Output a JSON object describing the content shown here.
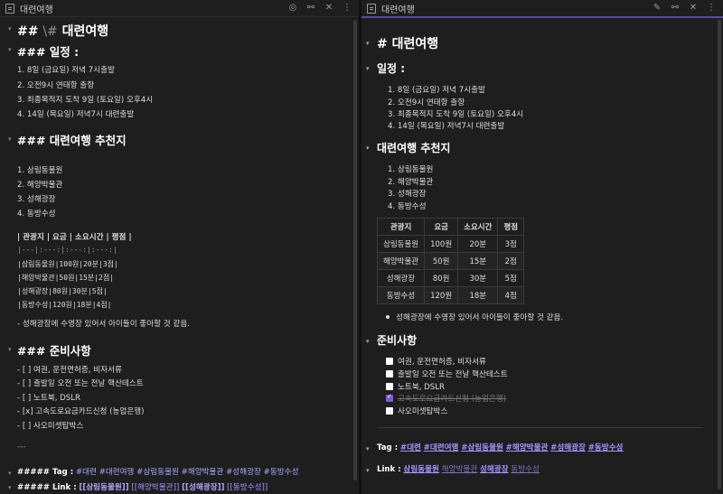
{
  "left_pane": {
    "tab_title": "대련여행",
    "icons": [
      "reading-glasses-icon",
      "link-icon",
      "close-icon",
      "more-icon"
    ],
    "lines": {
      "h2_mark": "##",
      "h2_escape": "\\#",
      "h2_text": "대련여행",
      "h3_schedule": "### 일정 :",
      "schedule": [
        "1. 8일 (금요일) 저녁 7시출발",
        "2. 오전9시 연태항 출항",
        "3. 최종목적지 도착 9일 (토요일) 오후4시",
        "4. 14일 (목요일) 저녁7시 대련출발"
      ],
      "h3_reco": "### 대련여행 추천지",
      "reco": [
        "1. 삼림동물원",
        "2. 해양박물관",
        "3. 성해광장",
        "4. 동방수성"
      ],
      "table_src": [
        "| 관광지 | 요금 | 소요시간 | 평점 |",
        "|---|:---:|:---:|:---:|",
        "|삼림동물원|100원|20분|3점|",
        "|해양박물관|50원|15분|2점|",
        "|성해광장|80원|30분|5점|",
        "|동방수성|120원|18분|4점|"
      ],
      "note": "- 성해광장에 수영장 있어서 아이들이 좋아할 것 같음.",
      "h3_prep": "### 준비사항",
      "prep": [
        "- [ ] 여권, 운전면허증, 비자서류",
        "- [ ] 출발일 오전 또는 전날 핵산테스트",
        "- [ ] 노트북, DSLR",
        "- [x] 고속도로요금카드신청 (농업은행)",
        "- [ ] 사오미셋탑박스"
      ],
      "rule": "---",
      "tag_prefix": "##### Tag :",
      "tag_items": "#대련 #대련여행 #삼림동물원 #해양박물관 #성해광장 #동방수성",
      "link_prefix": "##### Link :",
      "link_items": [
        "[[삼림동물원]]",
        "[[해양박물관]]",
        "[[성해광장]]",
        "[[동방수성]]"
      ]
    }
  },
  "right_pane": {
    "tab_title": "대련여행",
    "icons": [
      "edit-icon",
      "link-icon",
      "close-icon",
      "more-icon"
    ],
    "h1": "# 대련여행",
    "h_schedule": "일정 :",
    "schedule": [
      "1. 8일 (금요일) 저녁 7시출발",
      "2. 오전9시 연태항 출항",
      "3. 최종목적지 도착 9일 (토요일) 오후4시",
      "4. 14일 (목요일) 저녁7시 대련출발"
    ],
    "h_reco": "대련여행 추천지",
    "reco": [
      "1. 삼림동물원",
      "2. 해양박물관",
      "3. 성해광장",
      "4. 동방수성"
    ],
    "table": {
      "headers": [
        "관광지",
        "요금",
        "소요시간",
        "평점"
      ],
      "rows": [
        [
          "삼림동물원",
          "100원",
          "20분",
          "3점"
        ],
        [
          "해양박물관",
          "50원",
          "15분",
          "2점"
        ],
        [
          "성해광장",
          "80원",
          "30분",
          "5점"
        ],
        [
          "동방수성",
          "120원",
          "18분",
          "4점"
        ]
      ]
    },
    "note": "성해광장에 수영장 있어서 아이들이 좋아할 것 같음.",
    "h_prep": "준비사항",
    "prep": [
      {
        "text": "여권, 운전면허증, 비자서류",
        "checked": false
      },
      {
        "text": "출발일 오전 또는 전날 핵산테스트",
        "checked": false
      },
      {
        "text": "노트북, DSLR",
        "checked": false
      },
      {
        "text": "고속도로요금카드신청 (농업은행)",
        "checked": true
      },
      {
        "text": "사오미셋탑박스",
        "checked": false
      }
    ],
    "tag_label": "Tag :",
    "tags": [
      "#대련",
      "#대련여행",
      "#삼림동물원",
      "#해양박물관",
      "#성해광장",
      "#동방수성"
    ],
    "link_label": "Link :",
    "links": [
      "삼림동물원",
      "해양박물관",
      "성해광장",
      "동방수성"
    ]
  },
  "colors": {
    "accent": "#a692ff",
    "background": "#1e1e1e",
    "text": "#dcddde"
  }
}
